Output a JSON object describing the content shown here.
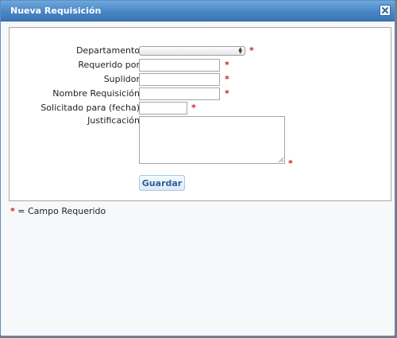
{
  "dialog": {
    "title": "Nueva Requisición",
    "close_icon": "close-icon"
  },
  "form": {
    "required_mark": "*",
    "fields": {
      "departamento": {
        "label": "Departamento",
        "value": ""
      },
      "requerido_por": {
        "label": "Requerido por",
        "value": ""
      },
      "suplidor": {
        "label": "Suplidor",
        "value": ""
      },
      "nombre_requisicion": {
        "label": "Nombre Requisición",
        "value": ""
      },
      "solicitado_para": {
        "label": "Solicitado para (fecha)",
        "value": ""
      },
      "justificacion": {
        "label": "Justificación",
        "value": ""
      }
    },
    "save_label": "Guardar"
  },
  "legend": {
    "star": "*",
    "text": "= Campo Requerido"
  },
  "colors": {
    "titlebar": "#4a86c5",
    "required": "#c4221f",
    "button_text": "#2c5f97"
  }
}
